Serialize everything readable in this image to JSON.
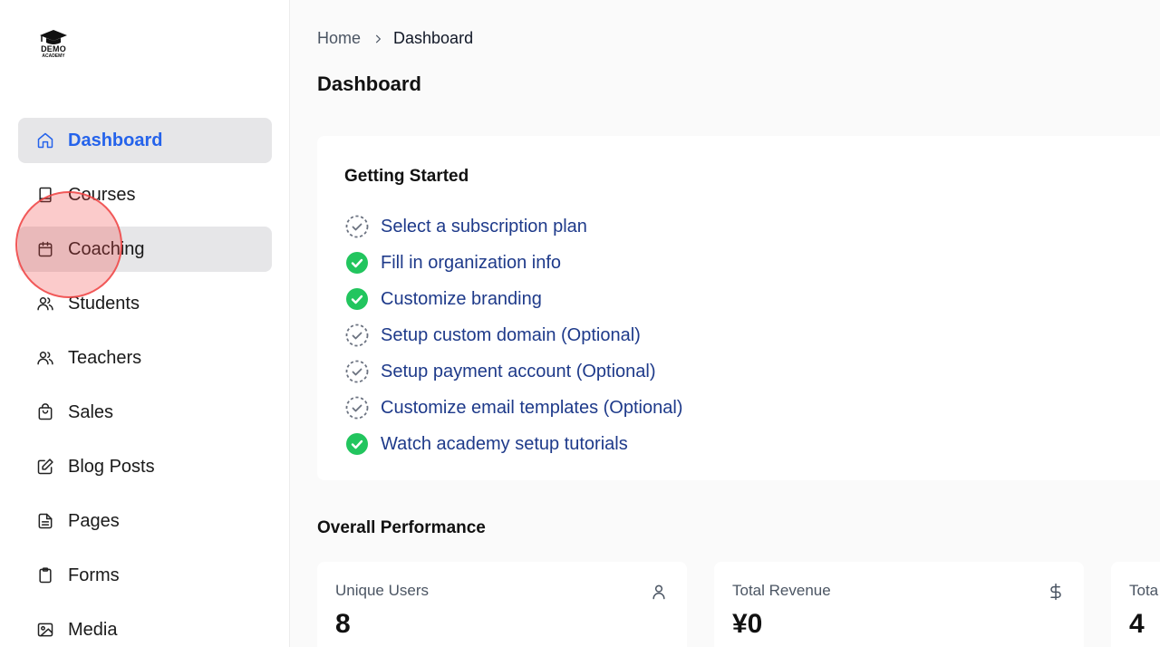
{
  "logo": {
    "line1": "DEMO",
    "line2": "ACADEMY",
    "icon": "graduation-cap-icon"
  },
  "sidebar": {
    "items": [
      {
        "label": "Dashboard",
        "icon": "home-icon",
        "active": true
      },
      {
        "label": "Courses",
        "icon": "book-icon"
      },
      {
        "label": "Coaching",
        "icon": "calendar-icon"
      },
      {
        "label": "Students",
        "icon": "users-icon"
      },
      {
        "label": "Teachers",
        "icon": "users-icon"
      },
      {
        "label": "Sales",
        "icon": "shopping-bag-icon"
      },
      {
        "label": "Blog Posts",
        "icon": "edit-icon"
      },
      {
        "label": "Pages",
        "icon": "file-text-icon"
      },
      {
        "label": "Forms",
        "icon": "clipboard-icon"
      },
      {
        "label": "Media",
        "icon": "image-icon"
      }
    ]
  },
  "breadcrumb": {
    "home": "Home",
    "current": "Dashboard"
  },
  "page": {
    "title": "Dashboard"
  },
  "getting_started": {
    "title": "Getting Started",
    "tasks": [
      {
        "label": "Select a subscription plan",
        "done": false
      },
      {
        "label": "Fill in organization info",
        "done": true
      },
      {
        "label": "Customize branding",
        "done": true
      },
      {
        "label": "Setup custom domain (Optional)",
        "done": false
      },
      {
        "label": "Setup payment account (Optional)",
        "done": false
      },
      {
        "label": "Customize email templates (Optional)",
        "done": false
      },
      {
        "label": "Watch academy setup tutorials",
        "done": true
      }
    ]
  },
  "performance": {
    "title": "Overall Performance",
    "stats": [
      {
        "label": "Unique Users",
        "value": "8",
        "icon": "user-icon"
      },
      {
        "label": "Total Revenue",
        "value": "¥0",
        "icon": "dollar-icon"
      },
      {
        "label": "Tota",
        "value": "4"
      }
    ]
  },
  "colors": {
    "accent": "#2563eb",
    "link": "#1e3a8a",
    "success": "#22c55e",
    "cursor": "#ef4444"
  }
}
